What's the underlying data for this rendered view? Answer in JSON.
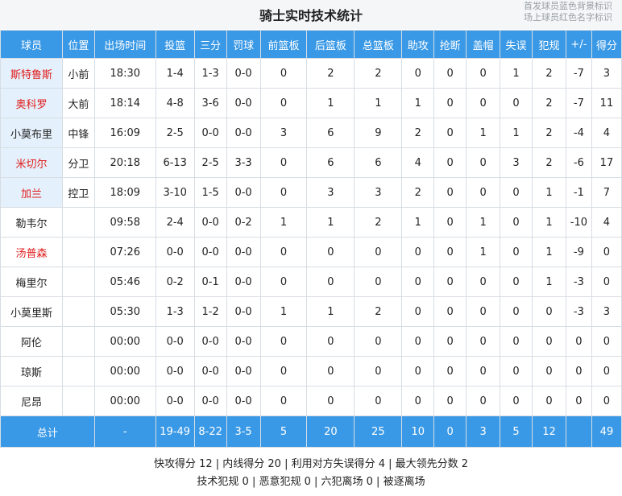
{
  "title": "骑士实时技术统计",
  "legend": [
    "首发球员蓝色背景标识",
    "场上球员红色名字标识"
  ],
  "colors": {
    "header_bg": "#3a99e6",
    "starter_bg": "#e4f0fb",
    "oncourt_text": "#e02020"
  },
  "columns": [
    "球员",
    "位置",
    "出场时间",
    "投篮",
    "三分",
    "罚球",
    "前篮板",
    "后篮板",
    "总篮板",
    "助攻",
    "抢断",
    "盖帽",
    "失误",
    "犯规",
    "+/-",
    "得分"
  ],
  "players": [
    {
      "cells": [
        "斯特鲁斯",
        "小前",
        "18:30",
        "1-4",
        "1-3",
        "0-0",
        "0",
        "2",
        "2",
        "0",
        "0",
        "0",
        "1",
        "2",
        "-7",
        "3"
      ],
      "starter": true,
      "oncourt": true
    },
    {
      "cells": [
        "奥科罗",
        "大前",
        "18:14",
        "4-8",
        "3-6",
        "0-0",
        "0",
        "1",
        "1",
        "1",
        "0",
        "0",
        "0",
        "2",
        "-7",
        "11"
      ],
      "starter": true,
      "oncourt": true
    },
    {
      "cells": [
        "小莫布里",
        "中锋",
        "16:09",
        "2-5",
        "0-0",
        "0-0",
        "3",
        "6",
        "9",
        "2",
        "0",
        "1",
        "1",
        "2",
        "-4",
        "4"
      ],
      "starter": true,
      "oncourt": false
    },
    {
      "cells": [
        "米切尔",
        "分卫",
        "20:18",
        "6-13",
        "2-5",
        "3-3",
        "0",
        "6",
        "6",
        "4",
        "0",
        "0",
        "3",
        "2",
        "-6",
        "17"
      ],
      "starter": true,
      "oncourt": true
    },
    {
      "cells": [
        "加兰",
        "控卫",
        "18:09",
        "3-10",
        "1-5",
        "0-0",
        "0",
        "3",
        "3",
        "2",
        "0",
        "0",
        "0",
        "1",
        "-1",
        "7"
      ],
      "starter": true,
      "oncourt": true
    },
    {
      "cells": [
        "勒韦尔",
        "",
        "09:58",
        "2-4",
        "0-0",
        "0-2",
        "1",
        "1",
        "2",
        "1",
        "0",
        "1",
        "0",
        "1",
        "-10",
        "4"
      ],
      "starter": false,
      "oncourt": false
    },
    {
      "cells": [
        "汤普森",
        "",
        "07:26",
        "0-0",
        "0-0",
        "0-0",
        "0",
        "0",
        "0",
        "0",
        "0",
        "1",
        "0",
        "1",
        "-9",
        "0"
      ],
      "starter": false,
      "oncourt": true
    },
    {
      "cells": [
        "梅里尔",
        "",
        "05:46",
        "0-2",
        "0-1",
        "0-0",
        "0",
        "0",
        "0",
        "0",
        "0",
        "0",
        "0",
        "1",
        "-3",
        "0"
      ],
      "starter": false,
      "oncourt": false
    },
    {
      "cells": [
        "小莫里斯",
        "",
        "05:30",
        "1-3",
        "1-2",
        "0-0",
        "1",
        "1",
        "2",
        "0",
        "0",
        "0",
        "0",
        "0",
        "-3",
        "3"
      ],
      "starter": false,
      "oncourt": false
    },
    {
      "cells": [
        "阿伦",
        "",
        "00:00",
        "0-0",
        "0-0",
        "0-0",
        "0",
        "0",
        "0",
        "0",
        "0",
        "0",
        "0",
        "0",
        "0",
        "0"
      ],
      "starter": false,
      "oncourt": false
    },
    {
      "cells": [
        "琼斯",
        "",
        "00:00",
        "0-0",
        "0-0",
        "0-0",
        "0",
        "0",
        "0",
        "0",
        "0",
        "0",
        "0",
        "0",
        "0",
        "0"
      ],
      "starter": false,
      "oncourt": false
    },
    {
      "cells": [
        "尼昂",
        "",
        "00:00",
        "0-0",
        "0-0",
        "0-0",
        "0",
        "0",
        "0",
        "0",
        "0",
        "0",
        "0",
        "0",
        "0",
        "0"
      ],
      "starter": false,
      "oncourt": false
    }
  ],
  "totals": {
    "label": "总计",
    "minutes": "-",
    "cells": [
      "19-49",
      "8-22",
      "3-5",
      "5",
      "20",
      "25",
      "10",
      "0",
      "3",
      "5",
      "12",
      "",
      "49"
    ]
  },
  "footer": {
    "line1": "快攻得分 12 | 内线得分 20 | 利用对方失误得分 4 | 最大领先分数 2",
    "line2": "技术犯规 0 | 恶意犯规 0 | 六犯离场 0 | 被逐离场"
  }
}
